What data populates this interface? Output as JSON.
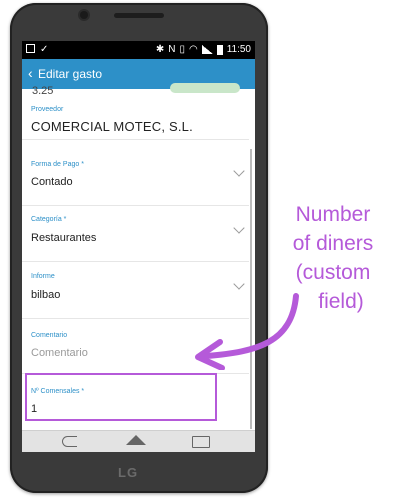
{
  "status_bar": {
    "time": "11:50",
    "left_icons": [
      "notification-icon",
      "check-icon"
    ],
    "right_icons": [
      "bluetooth-icon",
      "nfc-icon",
      "vibrate-icon",
      "wifi-icon",
      "signal-icon",
      "battery-icon"
    ]
  },
  "action_bar": {
    "back_glyph": "‹",
    "title": "Editar gasto"
  },
  "form": {
    "peek_value": "3.25",
    "proveedor": {
      "label": "Proveedor",
      "value": "COMERCIAL MOTEC, S.L."
    },
    "forma_pago": {
      "label": "Forma de Pago *",
      "value": "Contado"
    },
    "categoria": {
      "label": "Categoría *",
      "value": "Restaurantes"
    },
    "informe": {
      "label": "Informe",
      "value": "bilbao"
    },
    "comentario": {
      "label": "Comentario",
      "placeholder": "Comentario"
    },
    "comensales": {
      "label": "Nº Comensales *",
      "value": "1"
    }
  },
  "device": {
    "brand": "LG"
  },
  "annotation": {
    "line1": "Number",
    "line2": "of diners",
    "line3": "(custom",
    "line4": "field)",
    "color": "#b55ad9"
  },
  "colors": {
    "accent": "#2d90c8",
    "annotation": "#b55ad9"
  }
}
